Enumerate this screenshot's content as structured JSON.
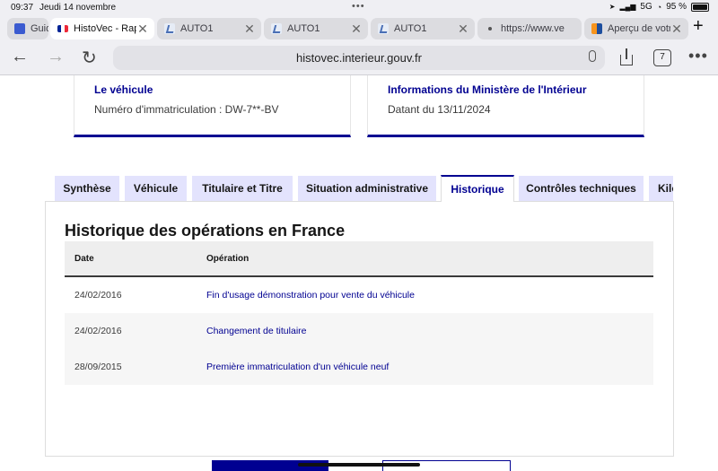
{
  "status": {
    "time": "09:37",
    "date": "Jeudi 14 novembre",
    "network": "5G",
    "battery": "95 %"
  },
  "browser": {
    "tabs": [
      {
        "title": "Guide",
        "favicon": "guide-icon",
        "active": false
      },
      {
        "title": "HistoVec - Rapport",
        "favicon": "french-flag-icon",
        "active": true
      },
      {
        "title": "AUTO1",
        "favicon": "auto1-icon",
        "active": false
      },
      {
        "title": "AUTO1",
        "favicon": "auto1-icon",
        "active": false
      },
      {
        "title": "AUTO1",
        "favicon": "auto1-icon",
        "active": false
      },
      {
        "title": "https://www.ve",
        "favicon": "dot-icon",
        "active": false
      },
      {
        "title": "Aperçu de votre",
        "favicon": "apercu-icon",
        "active": false
      }
    ],
    "new_tab": "+",
    "url": "histovec.interieur.gouv.fr",
    "tab_count": "7"
  },
  "cards": [
    {
      "title": "Le véhicule",
      "value": "Numéro d'immatriculation : DW-7**-BV"
    },
    {
      "title": "Informations du Ministère de l'Intérieur",
      "value": "Datant du 13/11/2024"
    }
  ],
  "content_tabs": [
    {
      "label": "Synthèse",
      "active": false
    },
    {
      "label": "Véhicule",
      "active": false
    },
    {
      "label": "Titulaire et Titre",
      "active": false
    },
    {
      "label": "Situation administrative",
      "active": false
    },
    {
      "label": "Historique",
      "active": true
    },
    {
      "label": "Contrôles techniques",
      "active": false
    },
    {
      "label": "Kilo",
      "active": false
    }
  ],
  "history": {
    "title": "Historique des opérations en France",
    "headers": {
      "date": "Date",
      "operation": "Opération"
    },
    "rows": [
      {
        "date": "24/02/2016",
        "operation": "Fin d'usage démonstration pour vente du véhicule"
      },
      {
        "date": "24/02/2016",
        "operation": "Changement de titulaire"
      },
      {
        "date": "28/09/2015",
        "operation": "Première immatriculation d'un véhicule neuf"
      }
    ]
  },
  "colors": {
    "accent": "#000091",
    "tab_bg": "#e3e3fd"
  }
}
